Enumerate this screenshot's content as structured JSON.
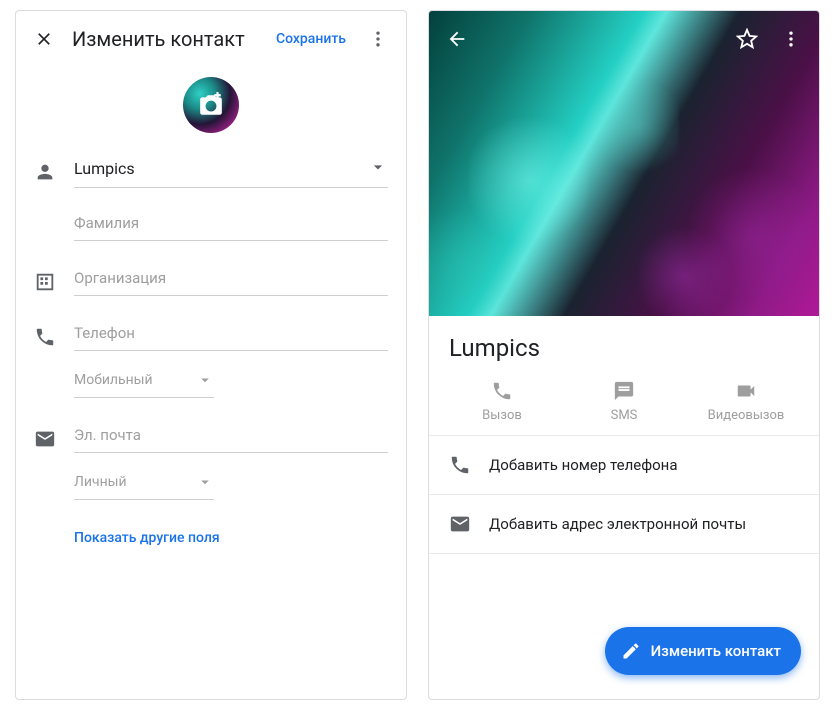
{
  "edit": {
    "title": "Изменить контакт",
    "save": "Сохранить",
    "first_name": "Lumpics",
    "last_name_ph": "Фамилия",
    "org_ph": "Организация",
    "phone_ph": "Телефон",
    "phone_type": "Мобильный",
    "email_ph": "Эл. почта",
    "email_type": "Личный",
    "more_fields": "Показать другие поля"
  },
  "view": {
    "name": "Lumpics",
    "call": "Вызов",
    "sms": "SMS",
    "video": "Видеовызов",
    "add_phone": "Добавить номер телефона",
    "add_email": "Добавить адрес электронной почты",
    "fab": "Изменить контакт"
  }
}
